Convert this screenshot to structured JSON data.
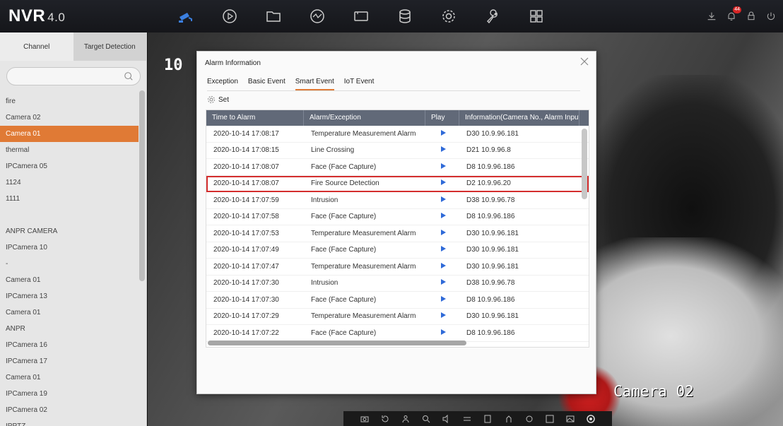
{
  "app": {
    "brand": "NVR",
    "version": "4.0"
  },
  "topnav": [
    "live-view-icon",
    "playback-icon",
    "file-icon",
    "smart-analysis-icon",
    "storage-device-icon",
    "database-icon",
    "settings-icon",
    "maintenance-icon",
    "grid-icon"
  ],
  "topright": {
    "alarm_count": "44"
  },
  "left_panel": {
    "tabs": [
      "Channel",
      "Target Detection"
    ],
    "search_placeholder": "",
    "channels": [
      "fire",
      "Camera 02",
      "Camera 01",
      "thermal",
      "IPCamera 05",
      "1124",
      "1111",
      "",
      "ANPR CAMERA",
      "IPCamera 10",
      "-",
      "Camera 01",
      "IPCamera 13",
      "Camera 01",
      "ANPR",
      "IPCamera 16",
      "IPCamera 17",
      "Camera 01",
      "IPCamera 19",
      "IPCamera 02",
      "IPPTZ"
    ],
    "active_index": 2
  },
  "video": {
    "channel_number": "10",
    "camera_label": "Camera 02"
  },
  "dialog": {
    "title": "Alarm Information",
    "tabs": [
      "Exception",
      "Basic Event",
      "Smart Event",
      "IoT Event"
    ],
    "active_tab": 2,
    "set_label": "Set",
    "columns": [
      "Time to Alarm",
      "Alarm/Exception",
      "Play",
      "Information(Camera No., Alarm Input"
    ],
    "rows": [
      [
        "2020-10-14 17:08:17",
        "Temperature Measurement Alarm",
        "D30  10.9.96.181"
      ],
      [
        "2020-10-14 17:08:15",
        "Line Crossing",
        "D21  10.9.96.8"
      ],
      [
        "2020-10-14 17:08:07",
        "Face (Face Capture)",
        "D8  10.9.96.186"
      ],
      [
        "2020-10-14 17:08:07",
        "Fire Source Detection",
        "D2  10.9.96.20"
      ],
      [
        "2020-10-14 17:07:59",
        "Intrusion",
        "D38  10.9.96.78"
      ],
      [
        "2020-10-14 17:07:58",
        "Face (Face Capture)",
        "D8  10.9.96.186"
      ],
      [
        "2020-10-14 17:07:53",
        "Temperature Measurement Alarm",
        "D30  10.9.96.181"
      ],
      [
        "2020-10-14 17:07:49",
        "Face (Face Capture)",
        "D30  10.9.96.181"
      ],
      [
        "2020-10-14 17:07:47",
        "Temperature Measurement Alarm",
        "D30  10.9.96.181"
      ],
      [
        "2020-10-14 17:07:30",
        "Intrusion",
        "D38  10.9.96.78"
      ],
      [
        "2020-10-14 17:07:30",
        "Face (Face Capture)",
        "D8  10.9.96.186"
      ],
      [
        "2020-10-14 17:07:29",
        "Temperature Measurement Alarm",
        "D30  10.9.96.181"
      ],
      [
        "2020-10-14 17:07:22",
        "Face (Face Capture)",
        "D8  10.9.96.186"
      ]
    ],
    "highlighted_row": 3
  },
  "bottom_toolbar": [
    "capture-icon",
    "instant-playback-icon",
    "person-icon",
    "zoom-icon",
    "audio-icon",
    "adjust-icon",
    "info-icon",
    "ptz-icon",
    "digital-zoom-icon",
    "target-icon",
    "image-icon",
    "thermal-icon"
  ],
  "colors": {
    "accent": "#e07a35",
    "table_header": "#616978",
    "highlight": "#d42e2e",
    "play": "#2f6ad8"
  }
}
